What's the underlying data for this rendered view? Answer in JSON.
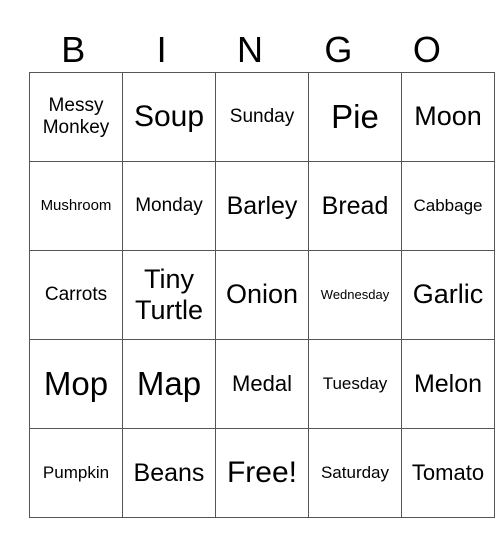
{
  "header": [
    "B",
    "I",
    "N",
    "G",
    "O"
  ],
  "rows": [
    [
      {
        "text": "Messy Monkey",
        "size": "s19"
      },
      {
        "text": "Soup",
        "size": "s30"
      },
      {
        "text": "Sunday",
        "size": "s19"
      },
      {
        "text": "Pie",
        "size": "s33"
      },
      {
        "text": "Moon",
        "size": "s27"
      }
    ],
    [
      {
        "text": "Mushroom",
        "size": "s15"
      },
      {
        "text": "Monday",
        "size": "s19"
      },
      {
        "text": "Barley",
        "size": "s25"
      },
      {
        "text": "Bread",
        "size": "s25"
      },
      {
        "text": "Cabbage",
        "size": "s17"
      }
    ],
    [
      {
        "text": "Carrots",
        "size": "s19"
      },
      {
        "text": "Tiny Turtle",
        "size": "s27"
      },
      {
        "text": "Onion",
        "size": "s27"
      },
      {
        "text": "Wednesday",
        "size": "s13"
      },
      {
        "text": "Garlic",
        "size": "s27"
      }
    ],
    [
      {
        "text": "Mop",
        "size": "s33"
      },
      {
        "text": "Map",
        "size": "s33"
      },
      {
        "text": "Medal",
        "size": "s22"
      },
      {
        "text": "Tuesday",
        "size": "s17"
      },
      {
        "text": "Melon",
        "size": "s25"
      }
    ],
    [
      {
        "text": "Pumpkin",
        "size": "s17"
      },
      {
        "text": "Beans",
        "size": "s25"
      },
      {
        "text": "Free!",
        "size": "s30"
      },
      {
        "text": "Saturday",
        "size": "s17"
      },
      {
        "text": "Tomato",
        "size": "s22"
      }
    ]
  ]
}
